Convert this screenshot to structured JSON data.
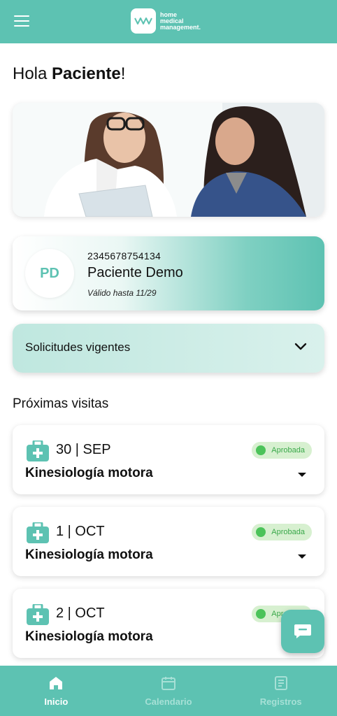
{
  "header": {
    "menu_icon": "hamburger-icon",
    "logo_line1": "home",
    "logo_line2": "medical",
    "logo_line3": "management.",
    "brand_color": "#5dc2b2"
  },
  "greeting": {
    "prefix": "Hola ",
    "name": "Paciente",
    "suffix": "!"
  },
  "patient_card": {
    "initials": "PD",
    "number": "2345678754134",
    "name": "Paciente Demo",
    "valid": "Válido hasta 11/29"
  },
  "requests": {
    "label": "Solicitudes vigentes"
  },
  "visits_section": {
    "title": "Próximas visitas"
  },
  "visits": [
    {
      "date": "30 | SEP",
      "title": "Kinesiología motora",
      "status": "Aprobada"
    },
    {
      "date": "1 | OCT",
      "title": "Kinesiología motora",
      "status": "Aprobada"
    },
    {
      "date": "2 | OCT",
      "title": "Kinesiología motora",
      "status": "Aprobada"
    }
  ],
  "chat": {
    "icon": "chat-icon"
  },
  "bottom_nav": {
    "items": [
      {
        "label": "Inicio",
        "icon": "home-icon",
        "active": true
      },
      {
        "label": "Calendario",
        "icon": "calendar-icon",
        "active": false
      },
      {
        "label": "Registros",
        "icon": "records-icon",
        "active": false
      }
    ]
  },
  "colors": {
    "approved_bg": "#d7f0d0",
    "approved_text": "#3aa84a",
    "approved_dot": "#4cc35a"
  }
}
